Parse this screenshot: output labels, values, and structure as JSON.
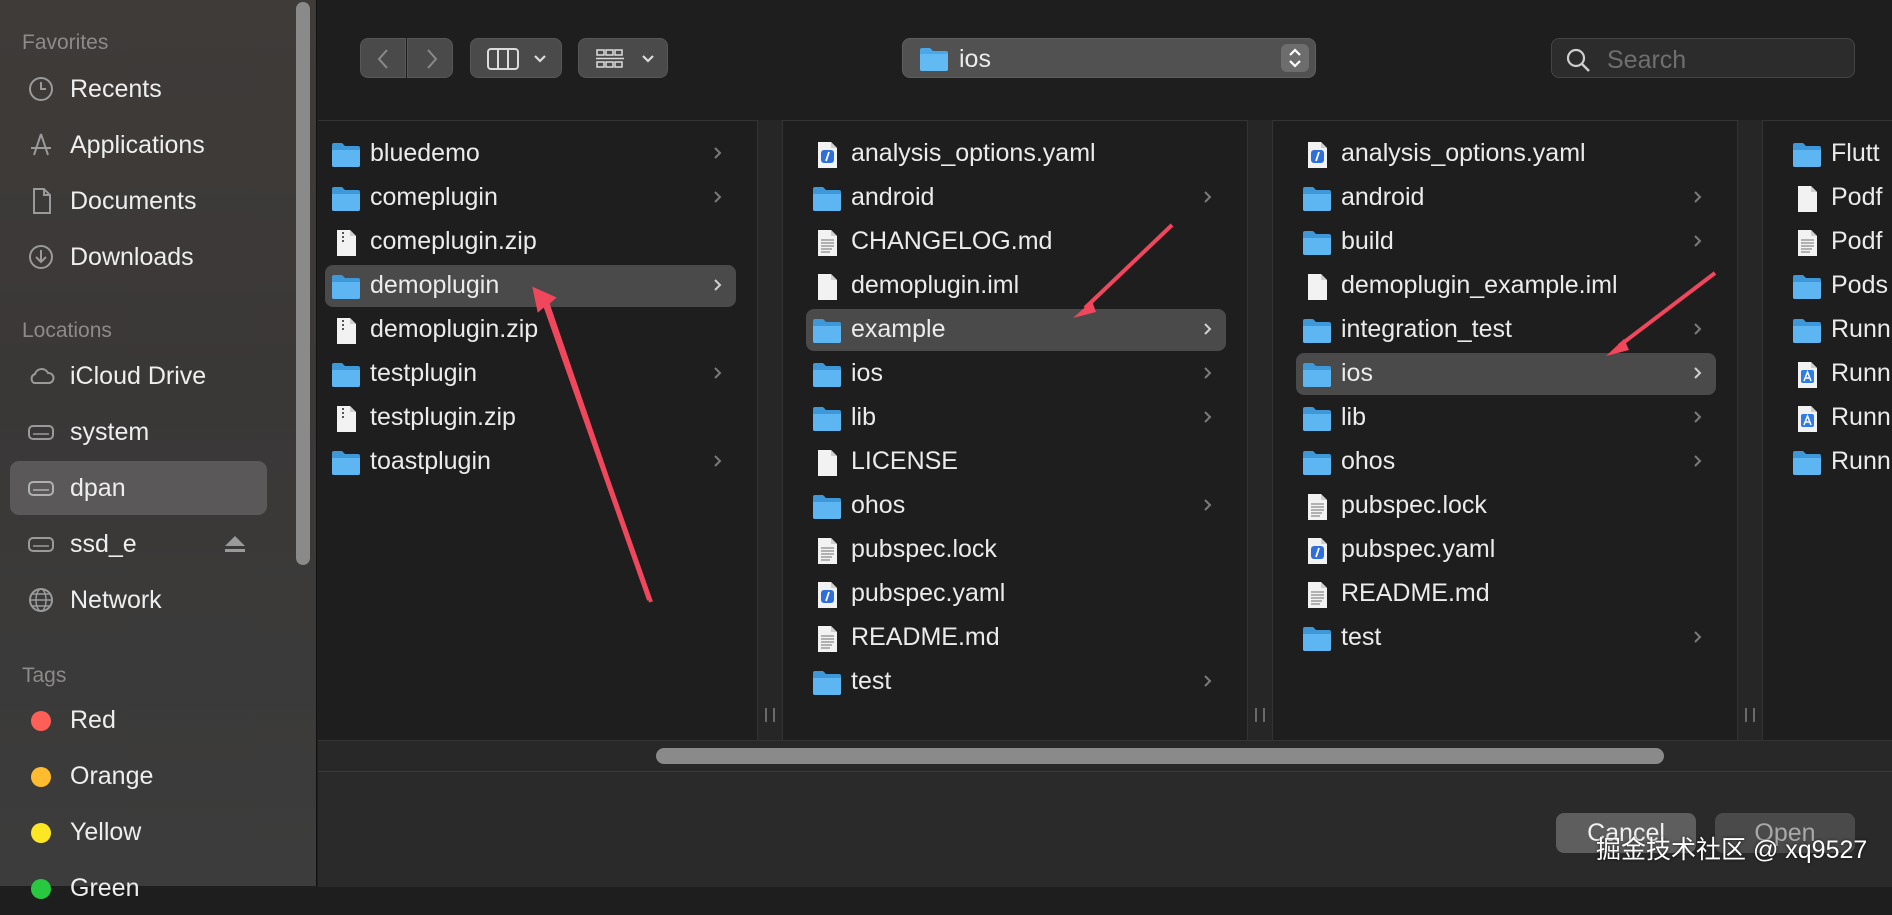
{
  "sidebar": {
    "favorites_header": "Favorites",
    "favorites": [
      {
        "label": "Recents",
        "icon": "clock-icon"
      },
      {
        "label": "Applications",
        "icon": "applications-icon"
      },
      {
        "label": "Documents",
        "icon": "document-icon"
      },
      {
        "label": "Downloads",
        "icon": "download-icon"
      }
    ],
    "locations_header": "Locations",
    "locations": [
      {
        "label": "iCloud Drive",
        "icon": "cloud-icon"
      },
      {
        "label": "system",
        "icon": "drive-icon"
      },
      {
        "label": "dpan",
        "icon": "drive-icon",
        "selected": true
      },
      {
        "label": "ssd_e",
        "icon": "drive-icon",
        "ejectable": true
      },
      {
        "label": "Network",
        "icon": "globe-icon"
      }
    ],
    "tags_header": "Tags",
    "tags": [
      {
        "label": "Red",
        "color": "#ff5f57"
      },
      {
        "label": "Orange",
        "color": "#febc2e"
      },
      {
        "label": "Yellow",
        "color": "#fde725"
      },
      {
        "label": "Green",
        "color": "#28c840"
      }
    ]
  },
  "toolbar": {
    "path_label": "ios",
    "search_placeholder": "Search"
  },
  "columns": [
    {
      "items": [
        {
          "label": "bluedemo",
          "kind": "folder",
          "chevron": true
        },
        {
          "label": "comeplugin",
          "kind": "folder",
          "chevron": true
        },
        {
          "label": "comeplugin.zip",
          "kind": "zip"
        },
        {
          "label": "demoplugin",
          "kind": "folder",
          "chevron": true,
          "selected": true
        },
        {
          "label": "demoplugin.zip",
          "kind": "zip"
        },
        {
          "label": "testplugin",
          "kind": "folder",
          "chevron": true
        },
        {
          "label": "testplugin.zip",
          "kind": "zip"
        },
        {
          "label": "toastplugin",
          "kind": "folder",
          "chevron": true
        }
      ]
    },
    {
      "items": [
        {
          "label": "analysis_options.yaml",
          "kind": "yaml"
        },
        {
          "label": "android",
          "kind": "folder",
          "chevron": true
        },
        {
          "label": "CHANGELOG.md",
          "kind": "text"
        },
        {
          "label": "demoplugin.iml",
          "kind": "blank"
        },
        {
          "label": "example",
          "kind": "folder",
          "chevron": true,
          "selected": true
        },
        {
          "label": "ios",
          "kind": "folder",
          "chevron": true
        },
        {
          "label": "lib",
          "kind": "folder",
          "chevron": true
        },
        {
          "label": "LICENSE",
          "kind": "blank"
        },
        {
          "label": "ohos",
          "kind": "folder",
          "chevron": true
        },
        {
          "label": "pubspec.lock",
          "kind": "text"
        },
        {
          "label": "pubspec.yaml",
          "kind": "yaml"
        },
        {
          "label": "README.md",
          "kind": "text"
        },
        {
          "label": "test",
          "kind": "folder",
          "chevron": true
        }
      ]
    },
    {
      "items": [
        {
          "label": "analysis_options.yaml",
          "kind": "yaml"
        },
        {
          "label": "android",
          "kind": "folder",
          "chevron": true
        },
        {
          "label": "build",
          "kind": "folder",
          "chevron": true
        },
        {
          "label": "demoplugin_example.iml",
          "kind": "blank"
        },
        {
          "label": "integration_test",
          "kind": "folder",
          "chevron": true
        },
        {
          "label": "ios",
          "kind": "folder",
          "chevron": true,
          "selected": true
        },
        {
          "label": "lib",
          "kind": "folder",
          "chevron": true
        },
        {
          "label": "ohos",
          "kind": "folder",
          "chevron": true
        },
        {
          "label": "pubspec.lock",
          "kind": "text"
        },
        {
          "label": "pubspec.yaml",
          "kind": "yaml"
        },
        {
          "label": "README.md",
          "kind": "text"
        },
        {
          "label": "test",
          "kind": "folder",
          "chevron": true
        }
      ]
    },
    {
      "items": [
        {
          "label": "Flutt",
          "kind": "folder"
        },
        {
          "label": "Podf",
          "kind": "blank"
        },
        {
          "label": "Podf",
          "kind": "text"
        },
        {
          "label": "Pods",
          "kind": "folder"
        },
        {
          "label": "Runn",
          "kind": "folder"
        },
        {
          "label": "Runn",
          "kind": "xcode"
        },
        {
          "label": "Runn",
          "kind": "xcode"
        },
        {
          "label": "Runn",
          "kind": "folder"
        }
      ]
    }
  ],
  "buttons": {
    "cancel": "Cancel",
    "open": "Open"
  },
  "watermark": "掘金技术社区 @ xq9527",
  "annotation_color": "#f0475c"
}
